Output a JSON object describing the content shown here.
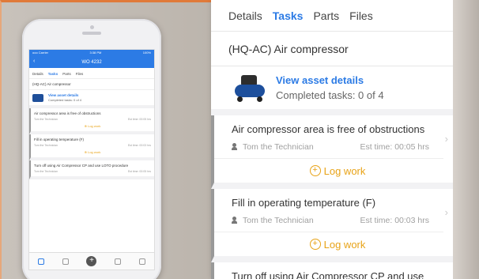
{
  "phone": {
    "status_left": "ooo Carrier",
    "status_time": "3:38 PM",
    "status_right": "100%",
    "nav_title": "WO 4232",
    "tabs": [
      "Details",
      "Tasks",
      "Parts",
      "Files"
    ],
    "active_tab": "Tasks",
    "asset_title": "(HQ-AC) Air compressor",
    "asset_link": "View asset details",
    "asset_sub": "Completed tasks: 0 of 4",
    "tasks": [
      {
        "title": "Air compressor area is free of obstructions",
        "tech": "Tom the Technician",
        "est": "Est time: 00:05 hrs",
        "log": "Log work"
      },
      {
        "title": "Fill in operating temperature (F)",
        "tech": "Tom the Technician",
        "est": "Est time: 00:03 hrs",
        "log": "Log work"
      },
      {
        "title": "Turn off using Air Compressor CP and use LOTO procedure",
        "tech": "Tom the Technician",
        "est": "Est time: 00:05 hrs",
        "log": "Log work"
      }
    ],
    "tabbar": [
      "Work orders",
      "Assets",
      "",
      "Scan",
      "More"
    ]
  },
  "panel": {
    "tabs": [
      "Details",
      "Tasks",
      "Parts",
      "Files"
    ],
    "active_tab": "Tasks",
    "asset_title": "(HQ-AC) Air compressor",
    "asset_link": "View asset details",
    "asset_sub": "Completed tasks: 0 of 4",
    "tasks": [
      {
        "title": "Air compressor area is free of obstructions",
        "tech": "Tom the Technician",
        "est": "Est time: 00:05 hrs",
        "log": "Log work"
      },
      {
        "title": "Fill in operating temperature (F)",
        "tech": "Tom the Technician",
        "est": "Est time: 00:03 hrs",
        "log": "Log work"
      },
      {
        "title": "Turn off using Air Compressor CP and use",
        "tech": "",
        "est": "",
        "log": ""
      }
    ]
  },
  "colors": {
    "accent": "#2c7be5",
    "log": "#e8a317",
    "frame": "#e07a3a"
  }
}
